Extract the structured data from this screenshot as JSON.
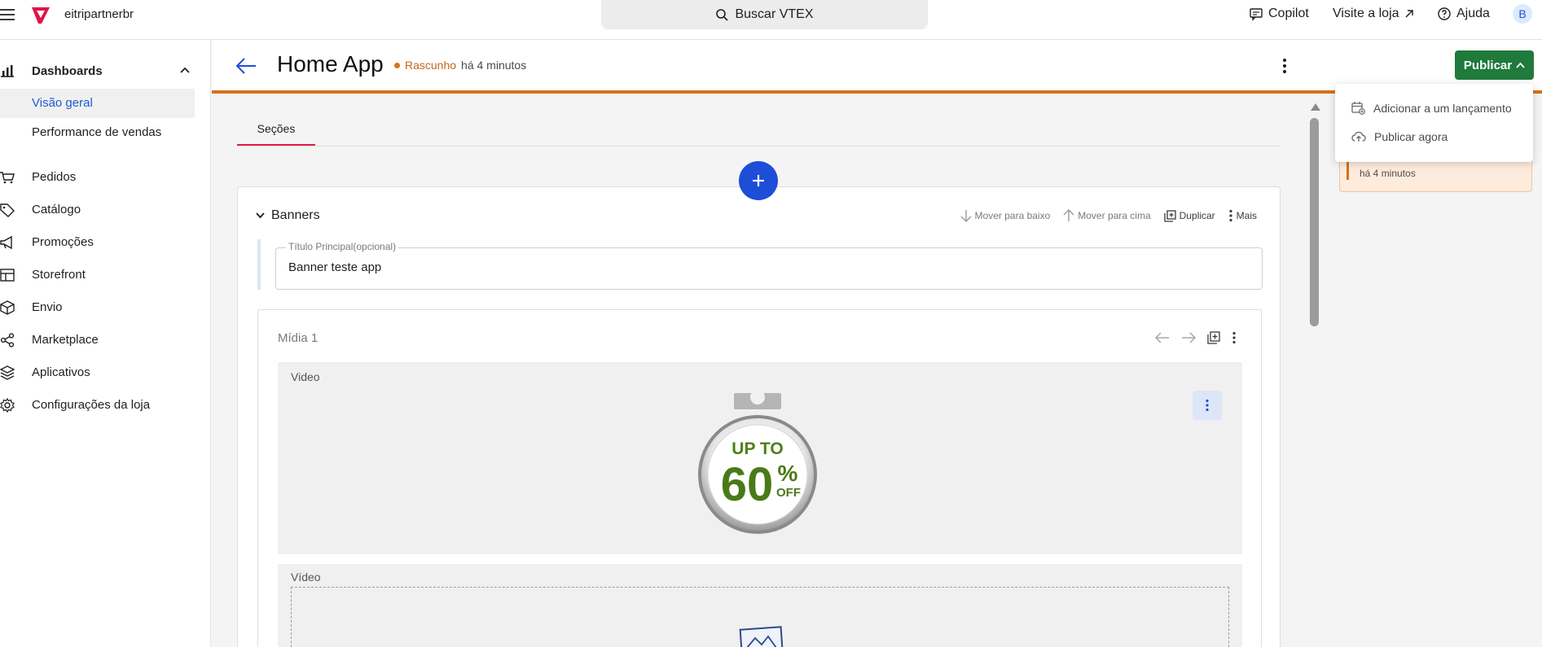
{
  "topbar": {
    "account": "eitripartnerbr",
    "search_label": "Buscar VTEX",
    "copilot": "Copilot",
    "visit_store": "Visite a loja",
    "help": "Ajuda",
    "avatar_initial": "B"
  },
  "sidebar": {
    "dashboards": {
      "label": "Dashboards",
      "items": [
        "Visão geral",
        "Performance de vendas"
      ]
    },
    "nav": [
      {
        "label": "Pedidos",
        "icon": "cart-icon"
      },
      {
        "label": "Catálogo",
        "icon": "tag-icon"
      },
      {
        "label": "Promoções",
        "icon": "megaphone-icon"
      },
      {
        "label": "Storefront",
        "icon": "layout-icon"
      },
      {
        "label": "Envio",
        "icon": "box-icon"
      },
      {
        "label": "Marketplace",
        "icon": "share-icon"
      },
      {
        "label": "Aplicativos",
        "icon": "layers-icon"
      },
      {
        "label": "Configurações da loja",
        "icon": "gear-icon"
      }
    ]
  },
  "page": {
    "title": "Home App",
    "status_draft": "Rascunho",
    "status_time": "há 4 minutos",
    "publish_label": "Publicar"
  },
  "tabs": [
    "Seções"
  ],
  "section": {
    "title": "Banners",
    "actions": {
      "move_down": "Mover para baixo",
      "move_up": "Mover para cima",
      "duplicate": "Duplicar",
      "more": "Mais"
    },
    "title_field": {
      "label": "Título Principal(opcional)",
      "value": "Banner teste app"
    },
    "media": {
      "title": "Mídia 1",
      "video_label_1": "Video",
      "video_label_2": "Vídeo",
      "badge_line1": "UP TO",
      "badge_number": "60",
      "badge_percent": "%",
      "badge_off": "OFF"
    }
  },
  "dropdown": {
    "items": [
      "Adicionar a um lançamento",
      "Publicar agora"
    ]
  },
  "notice": {
    "time": "há 4 minutos"
  },
  "colors": {
    "accent_orange": "#d4721c",
    "publish_green": "#1f7a3c",
    "primary_blue": "#1d4ed8",
    "tab_underline": "#e11d48"
  }
}
